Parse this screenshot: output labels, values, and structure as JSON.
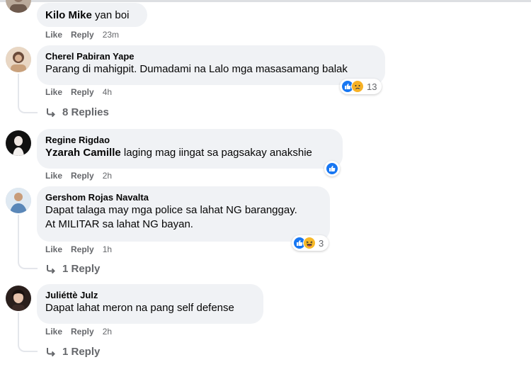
{
  "actions": {
    "like": "Like",
    "reply": "Reply"
  },
  "comments": [
    {
      "author": "Kilo Mike",
      "text": "yan boi",
      "time": "23m"
    },
    {
      "author": "Cherel Pabiran Yape",
      "text": "Parang di mahigpit. Dumadami na Lalo mga masasamang balak",
      "time": "4h",
      "reaction_count": "13",
      "replies": "8 Replies"
    },
    {
      "author": "Regine Rigdao",
      "tag": "Yzarah Camille",
      "text": "laging mag iingat sa pagsakay anakshie",
      "time": "2h"
    },
    {
      "author": "Gershom Rojas Navalta",
      "text_line1": "Dapat talaga may mga police sa lahat NG baranggay.",
      "text_line2": "At MILITAR sa lahat NG bayan.",
      "time": "1h",
      "reaction_count": "3",
      "replies": "1 Reply"
    },
    {
      "author": "Juliéttè Julz",
      "text": "Dapat lahat meron na pang self defense",
      "time": "2h",
      "replies": "1 Reply"
    }
  ],
  "colors": {
    "bubble": "#f0f2f5",
    "meta": "#65676b",
    "like_blue": "#1877f2",
    "sad_yellow": "#f7b125",
    "haha_yellow": "#f7b928"
  },
  "icons": [
    "like-reaction-icon",
    "sad-reaction-icon",
    "haha-reaction-icon",
    "reply-arrow-icon"
  ]
}
